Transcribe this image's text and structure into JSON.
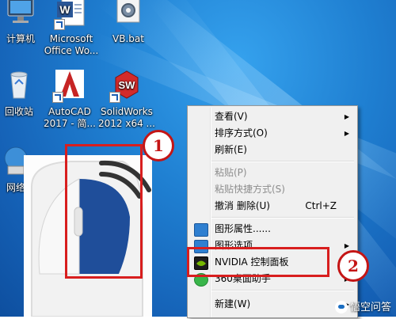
{
  "desktop": {
    "icons": [
      {
        "id": "computer",
        "label": "计算机"
      },
      {
        "id": "word",
        "label": "Microsoft Office Wo..."
      },
      {
        "id": "vbbat",
        "label": "VB.bat"
      },
      {
        "id": "recycle",
        "label": "回收站"
      },
      {
        "id": "autocad",
        "label": "AutoCAD 2017 - 简..."
      },
      {
        "id": "solidworks",
        "label": "SolidWorks 2012 x64 ..."
      },
      {
        "id": "network",
        "label": "网络"
      }
    ]
  },
  "context_menu": {
    "items": [
      {
        "label": "查看(V)",
        "submenu": true,
        "disabled": false
      },
      {
        "label": "排序方式(O)",
        "submenu": true,
        "disabled": false
      },
      {
        "label": "刷新(E)",
        "submenu": false,
        "disabled": false
      },
      {
        "label": "粘贴(P)",
        "submenu": false,
        "disabled": true
      },
      {
        "label": "粘贴快捷方式(S)",
        "submenu": false,
        "disabled": true
      },
      {
        "label": "撤消 删除(U)",
        "shortcut": "Ctrl+Z",
        "submenu": false,
        "disabled": false
      },
      {
        "label": "图形属性......",
        "submenu": false,
        "disabled": false
      },
      {
        "label": "图形选项",
        "submenu": true,
        "disabled": false
      },
      {
        "label": "NVIDIA 控制面板",
        "submenu": false,
        "disabled": false
      },
      {
        "label": "360桌面助手",
        "submenu": true,
        "disabled": false
      },
      {
        "label": "新建(W)",
        "submenu": true,
        "disabled": false
      }
    ]
  },
  "annotations": {
    "step1": "1",
    "step2": "2"
  },
  "watermark": {
    "text": "悟空问答"
  },
  "colors": {
    "annotation_red": "#d81e1e",
    "desktop_blue": "#1f7fd1",
    "mouse_button_blue": "#1f4e9a"
  }
}
